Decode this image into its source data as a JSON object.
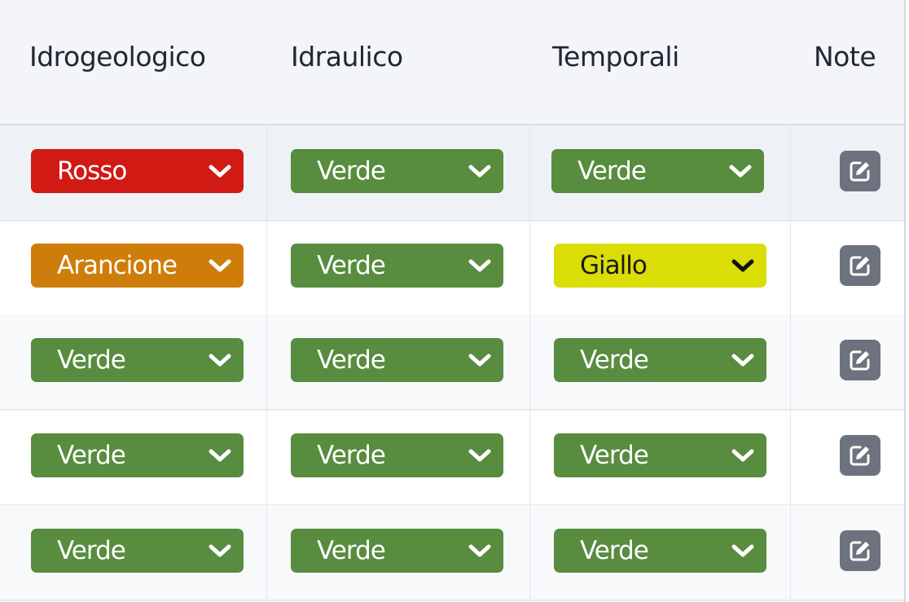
{
  "columns": [
    "Idrogeologico",
    "Idraulico",
    "Temporali",
    "Note"
  ],
  "colors": {
    "Rosso": "#d11a14",
    "Arancione": "#cf7d0a",
    "Verde": "#588c3e",
    "Giallo": "#dadd06"
  },
  "rows": [
    {
      "idrogeologico": "Rosso",
      "idraulico": "Verde",
      "temporali": "Verde",
      "note_icon": "edit-icon"
    },
    {
      "idrogeologico": "Arancione",
      "idraulico": "Verde",
      "temporali": "Giallo",
      "note_icon": "edit-icon"
    },
    {
      "idrogeologico": "Verde",
      "idraulico": "Verde",
      "temporali": "Verde",
      "note_icon": "edit-icon"
    },
    {
      "idrogeologico": "Verde",
      "idraulico": "Verde",
      "temporali": "Verde",
      "note_icon": "edit-icon"
    },
    {
      "idrogeologico": "Verde",
      "idraulico": "Verde",
      "temporali": "Verde",
      "note_icon": "edit-icon"
    }
  ]
}
